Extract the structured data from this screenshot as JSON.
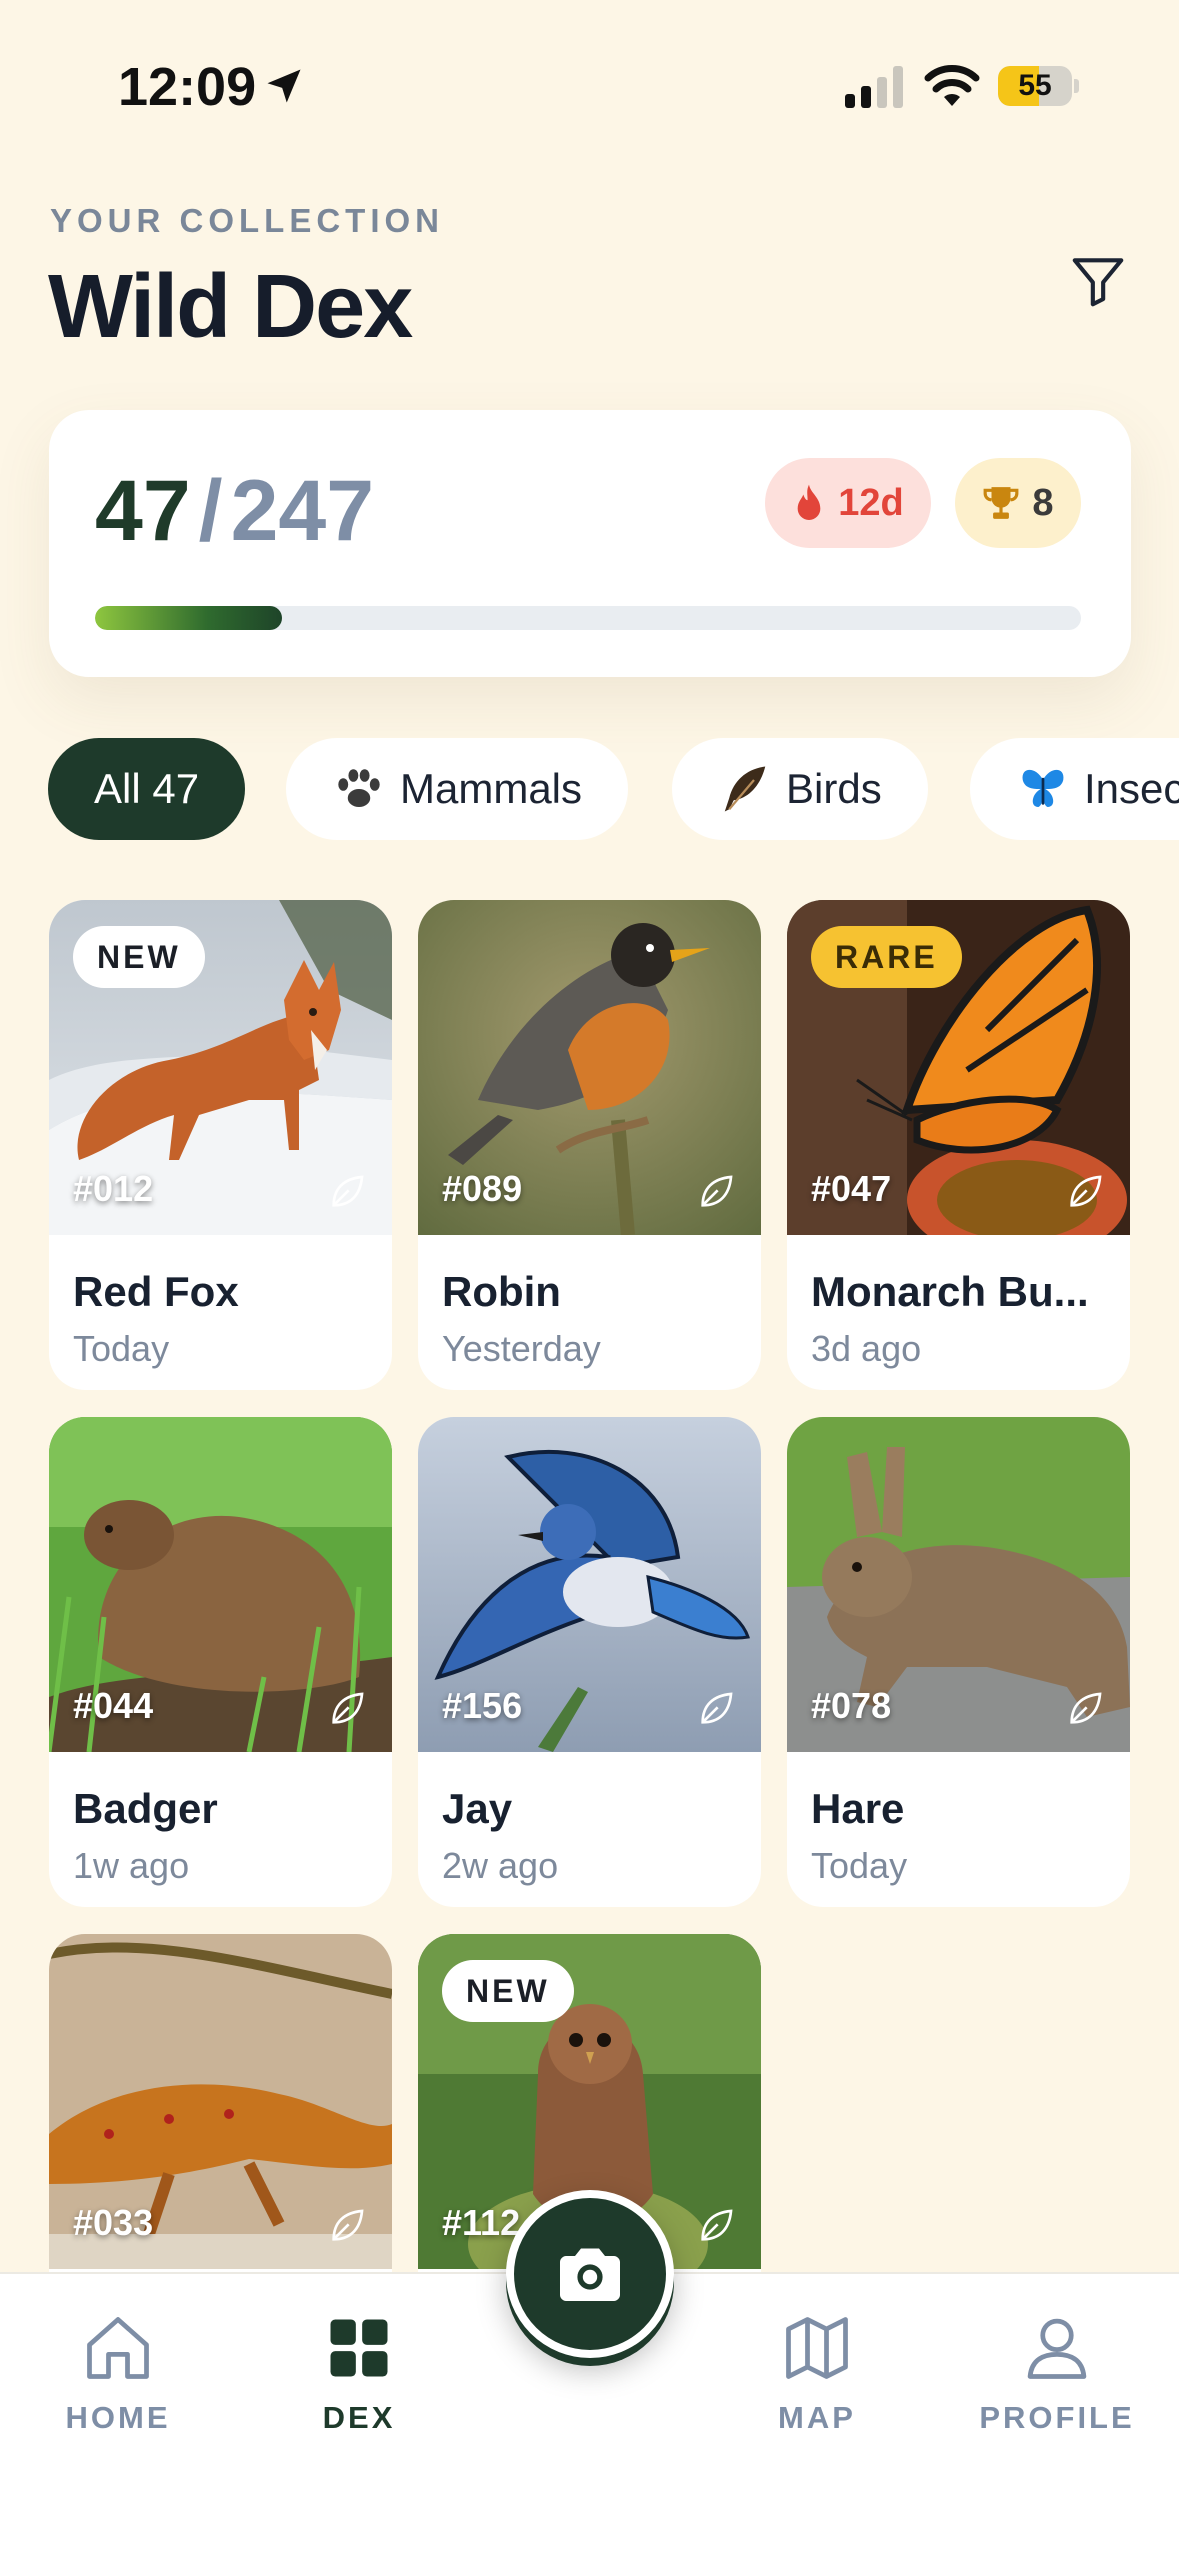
{
  "status_bar": {
    "time": "12:09",
    "battery": "55",
    "battery_level": 0.55
  },
  "header": {
    "eyebrow": "YOUR COLLECTION",
    "title": "Wild Dex"
  },
  "progress": {
    "caught": "47",
    "separator": "/",
    "total": "247",
    "fraction": 0.19,
    "streak": "12d",
    "trophies": "8"
  },
  "chips": [
    {
      "label": "All 47",
      "active": true
    },
    {
      "label": "Mammals",
      "icon": "paw-icon"
    },
    {
      "label": "Birds",
      "icon": "feather-icon"
    },
    {
      "label": "Insects",
      "icon": "butterfly-icon"
    }
  ],
  "cards": [
    {
      "id": "#012",
      "name": "Red Fox",
      "time": "Today",
      "badge": "NEW"
    },
    {
      "id": "#089",
      "name": "Robin",
      "time": "Yesterday"
    },
    {
      "id": "#047",
      "name": "Monarch Bu...",
      "time": "3d ago",
      "badge": "RARE"
    },
    {
      "id": "#044",
      "name": "Badger",
      "time": "1w ago"
    },
    {
      "id": "#156",
      "name": "Jay",
      "time": "2w ago"
    },
    {
      "id": "#078",
      "name": "Hare",
      "time": "Today"
    },
    {
      "id": "#033"
    },
    {
      "id": "#112",
      "badge": "NEW"
    }
  ],
  "nav": {
    "home": "HOME",
    "dex": "DEX",
    "map": "MAP",
    "profile": "PROFILE",
    "active": "dex"
  },
  "colors": {
    "background": "#fdf6e6",
    "primary": "#1e3a2b",
    "streak": "#e2453a",
    "rare": "#f6c231"
  }
}
